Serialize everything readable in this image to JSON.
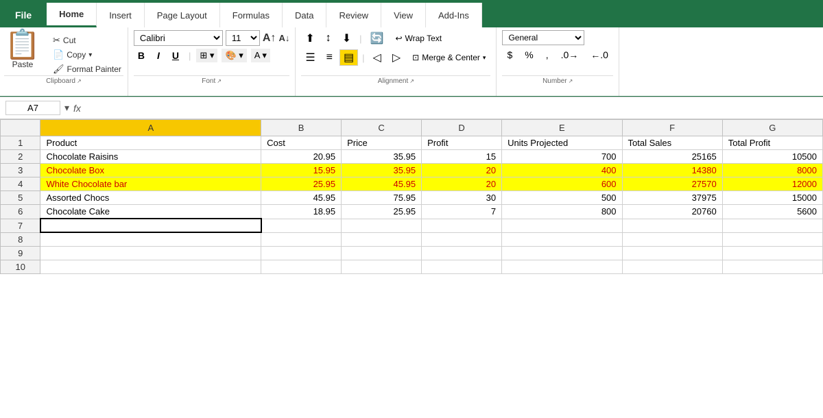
{
  "tabs": {
    "file": "File",
    "home": "Home",
    "insert": "Insert",
    "page_layout": "Page Layout",
    "formulas": "Formulas",
    "data": "Data",
    "review": "Review",
    "view": "View",
    "add_ins": "Add-Ins"
  },
  "clipboard": {
    "paste": "Paste",
    "cut": "Cut",
    "copy": "Copy",
    "format_painter": "Format Painter",
    "group_label": "Clipboard"
  },
  "font": {
    "font_name": "Calibri",
    "font_size": "11",
    "bold": "B",
    "italic": "I",
    "underline": "U",
    "group_label": "Font"
  },
  "alignment": {
    "wrap_text": "Wrap Text",
    "merge_center": "Merge & Center",
    "group_label": "Alignment"
  },
  "number": {
    "format": "General",
    "dollar": "$",
    "percent": "%",
    "group_label": "Number"
  },
  "formula_bar": {
    "cell_ref": "A7",
    "fx": "fx"
  },
  "spreadsheet": {
    "columns": [
      "",
      "A",
      "B",
      "C",
      "D",
      "E",
      "F",
      "G"
    ],
    "rows": [
      {
        "num": "1",
        "cells": [
          "Product",
          "Cost",
          "Price",
          "Profit",
          "Units Projected",
          "Total Sales",
          "Total Profit"
        ]
      },
      {
        "num": "2",
        "cells": [
          "Chocolate Raisins",
          "20.95",
          "35.95",
          "15",
          "700",
          "25165",
          "10500"
        ]
      },
      {
        "num": "3",
        "cells": [
          "Chocolate Box",
          "15.95",
          "35.95",
          "20",
          "400",
          "14380",
          "8000"
        ],
        "highlight": true
      },
      {
        "num": "4",
        "cells": [
          "White Chocolate bar",
          "25.95",
          "45.95",
          "20",
          "600",
          "27570",
          "12000"
        ],
        "highlight": true
      },
      {
        "num": "5",
        "cells": [
          "Assorted Chocs",
          "45.95",
          "75.95",
          "30",
          "500",
          "37975",
          "15000"
        ]
      },
      {
        "num": "6",
        "cells": [
          "Chocolate Cake",
          "18.95",
          "25.95",
          "7",
          "800",
          "20760",
          "5600"
        ]
      },
      {
        "num": "7",
        "cells": [
          "",
          "",
          "",
          "",
          "",
          "",
          ""
        ],
        "selected_a": true
      },
      {
        "num": "8",
        "cells": [
          "",
          "",
          "",
          "",
          "",
          "",
          ""
        ]
      },
      {
        "num": "9",
        "cells": [
          "",
          "",
          "",
          "",
          "",
          "",
          ""
        ]
      },
      {
        "num": "10",
        "cells": [
          "",
          "",
          "",
          "",
          "",
          "",
          ""
        ]
      }
    ]
  }
}
